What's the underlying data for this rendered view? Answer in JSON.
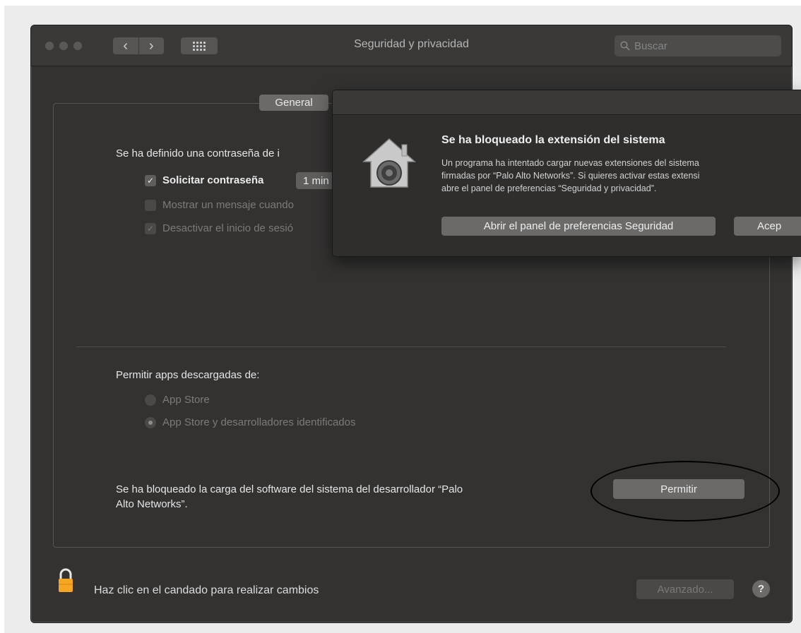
{
  "window": {
    "title": "Seguridad y privacidad",
    "search_placeholder": "Buscar",
    "nav_back": "‹",
    "nav_forward": "›"
  },
  "tabs": {
    "general": "General"
  },
  "general": {
    "password_heading": "Se ha definido una contraseña de i",
    "require_password_label": "Solicitar contraseña",
    "require_password_checked": true,
    "require_password_delay": "1 min",
    "show_message_label": "Mostrar un mensaje cuando",
    "show_message_checked": false,
    "disable_login_label": "Desactivar el inicio de sesió",
    "disable_login_checked": true,
    "allow_apps_heading": "Permitir apps descargadas de:",
    "radio_app_store": "App Store",
    "radio_identified": "App Store y desarrolladores identificados",
    "blocked_line1": "Se ha bloqueado la carga del software del sistema del desarrollador “Palo",
    "blocked_line2": "Alto Networks”.",
    "allow_button": "Permitir"
  },
  "footer": {
    "lock_text": "Haz clic en el candado para realizar cambios",
    "advanced_button": "Avanzado...",
    "help_button": "?"
  },
  "dialog": {
    "title": "Se ha bloqueado la extensión del sistema",
    "body_line1": "Un programa ha intentado cargar nuevas extensiones del sistema",
    "body_line2": "firmadas por “Palo Alto Networks”. Si quieres activar estas extensi",
    "body_line3": "abre el panel de preferencias “Seguridad y privacidad”.",
    "open_button": "Abrir el panel de preferencias Seguridad",
    "accept_button": "Acep"
  },
  "icons": {
    "search": "search-icon",
    "lock": "lock-icon",
    "dialog": "security-house-icon",
    "grid": "grid-icon"
  },
  "colors": {
    "window_bg": "#333231",
    "lock_orange": "#f6a623",
    "button_bg": "#6b6a69"
  }
}
